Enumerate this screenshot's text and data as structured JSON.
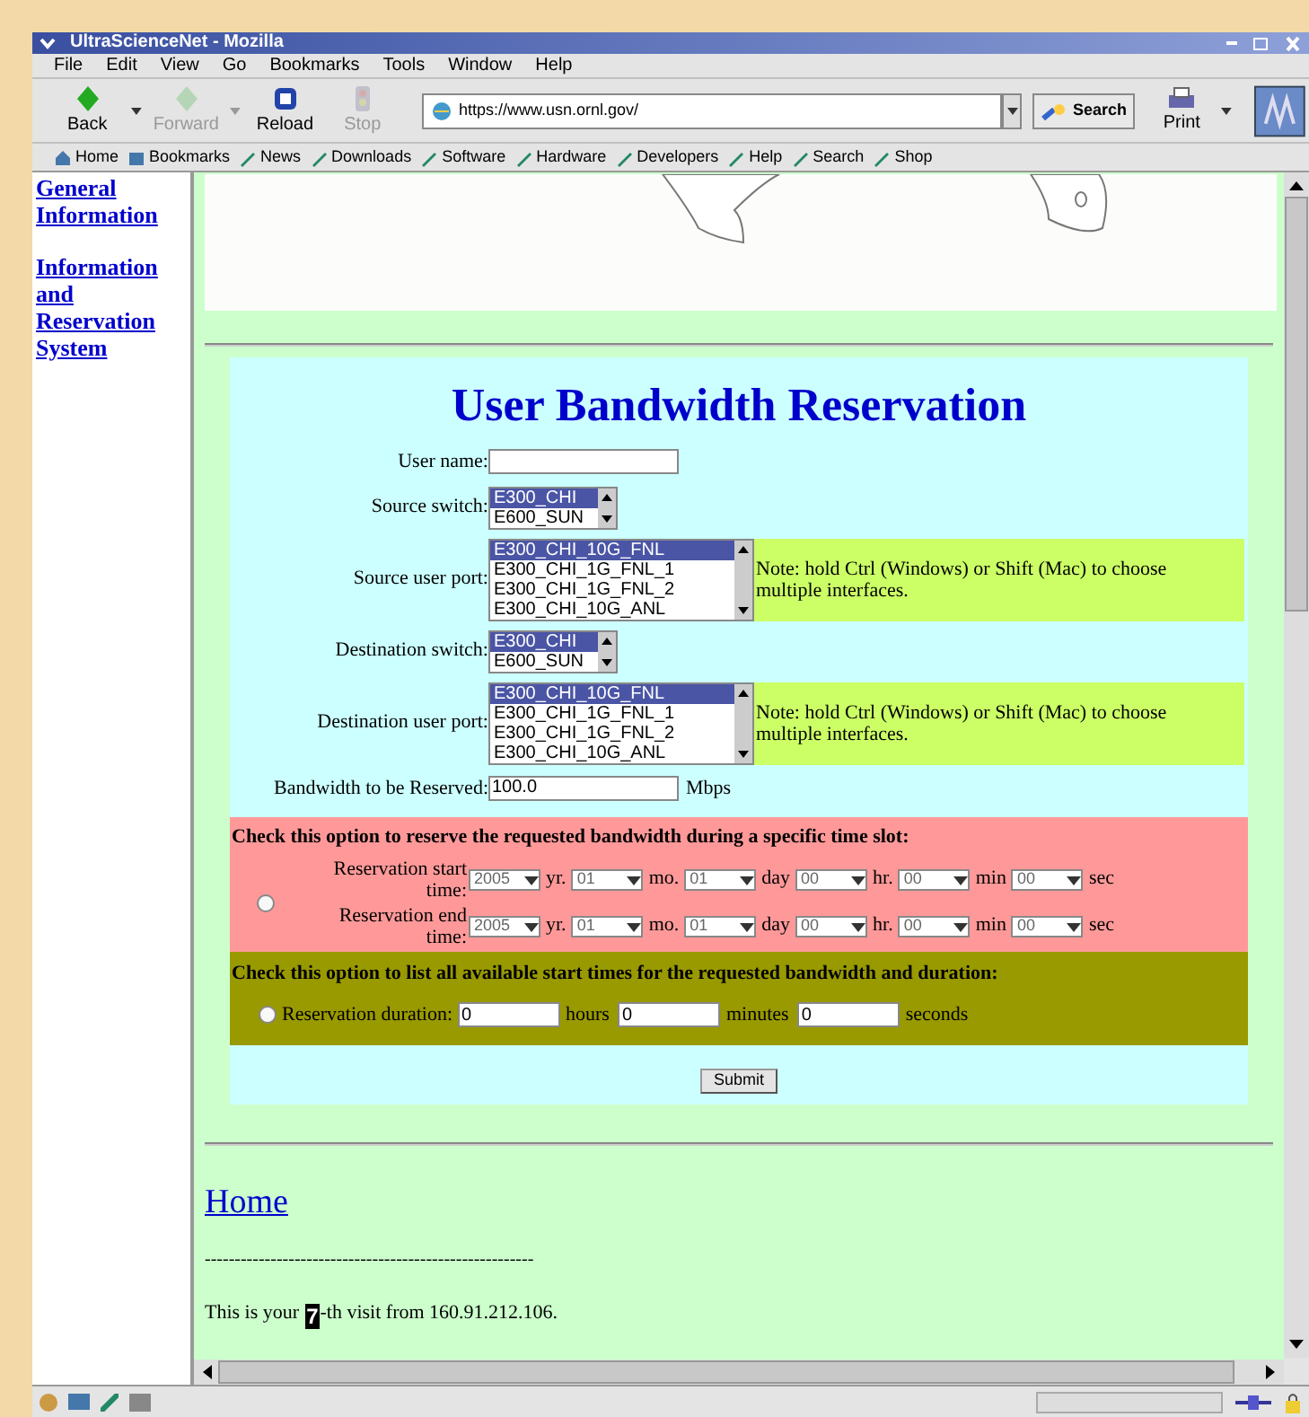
{
  "window": {
    "title": "UltraScienceNet - Mozilla"
  },
  "menu": [
    "File",
    "Edit",
    "View",
    "Go",
    "Bookmarks",
    "Tools",
    "Window",
    "Help"
  ],
  "toolbar": [
    {
      "label": "Back",
      "disabled": false
    },
    {
      "label": "Forward",
      "disabled": true
    },
    {
      "label": "Reload",
      "disabled": false
    },
    {
      "label": "Stop",
      "disabled": true
    }
  ],
  "address": "https://www.usn.ornl.gov/",
  "search_button": "Search",
  "print_button": "Print",
  "personal_toolbar": [
    "Home",
    "Bookmarks",
    "News",
    "Downloads",
    "Software",
    "Hardware",
    "Developers",
    "Help",
    "Search",
    "Shop"
  ],
  "sidebar": {
    "links": [
      "General Information",
      "Information and Reservation System"
    ]
  },
  "form": {
    "title": "User Bandwidth Reservation",
    "fields": [
      {
        "kind": "text",
        "label": "User name:"
      },
      {
        "kind": "list",
        "label": "Source switch:",
        "options": [
          {
            "text": "E300_CHI",
            "selected": true
          },
          {
            "text": "E600_SUN",
            "selected": false
          }
        ]
      },
      {
        "kind": "list",
        "label": "Source user port:",
        "note": "Note: hold Ctrl (Windows) or Shift (Mac) to choose multiple interfaces.",
        "options": [
          {
            "text": "E300_CHI_10G_FNL",
            "selected": true
          },
          {
            "text": "E300_CHI_1G_FNL_1",
            "selected": false
          },
          {
            "text": "E300_CHI_1G_FNL_2",
            "selected": false
          },
          {
            "text": "E300_CHI_10G_ANL",
            "selected": false
          }
        ]
      },
      {
        "kind": "list",
        "label": "Destination switch:",
        "options": [
          {
            "text": "E300_CHI",
            "selected": true
          },
          {
            "text": "E600_SUN",
            "selected": false
          }
        ]
      },
      {
        "kind": "list",
        "label": "Destination user port:",
        "note": "Note: hold Ctrl (Windows) or Shift (Mac) to choose multiple interfaces.",
        "options": [
          {
            "text": "E300_CHI_10G_FNL",
            "selected": true
          },
          {
            "text": "E300_CHI_1G_FNL_1",
            "selected": false
          },
          {
            "text": "E300_CHI_1G_FNL_2",
            "selected": false
          },
          {
            "text": "E300_CHI_10G_ANL",
            "selected": false
          }
        ]
      },
      {
        "kind": "text",
        "label": "Bandwidth to be Reserved:",
        "value": "100.0",
        "unit": "Mbps"
      }
    ],
    "timeslot": {
      "heading": "Check this option to reserve the requested bandwidth during a specific time slot:",
      "selected": false,
      "rows": [
        {
          "label": "Reservation start time:",
          "parts": [
            {
              "value": "2005",
              "unit": "yr."
            },
            {
              "value": "01",
              "unit": "mo."
            },
            {
              "value": "01",
              "unit": "day"
            },
            {
              "value": "00",
              "unit": "hr."
            },
            {
              "value": "00",
              "unit": "min"
            },
            {
              "value": "00",
              "unit": "sec"
            }
          ]
        },
        {
          "label": "Reservation end time:",
          "parts": [
            {
              "value": "2005",
              "unit": "yr."
            },
            {
              "value": "01",
              "unit": "mo."
            },
            {
              "value": "01",
              "unit": "day"
            },
            {
              "value": "00",
              "unit": "hr."
            },
            {
              "value": "00",
              "unit": "min"
            },
            {
              "value": "00",
              "unit": "sec"
            }
          ]
        }
      ]
    },
    "duration": {
      "heading": "Check this option to list all available start times for the requested bandwidth and duration:",
      "selected": false,
      "label": "Reservation duration:",
      "parts": [
        {
          "value": "0",
          "unit": "hours"
        },
        {
          "value": "0",
          "unit": "minutes"
        },
        {
          "value": "0",
          "unit": "seconds"
        }
      ]
    },
    "submit": "Submit"
  },
  "home_link": "Home",
  "separator": "-------------------------------------------------------",
  "visit": {
    "before": "This is your",
    "count": "7",
    "after": "-th visit from 160.91.212.106."
  }
}
